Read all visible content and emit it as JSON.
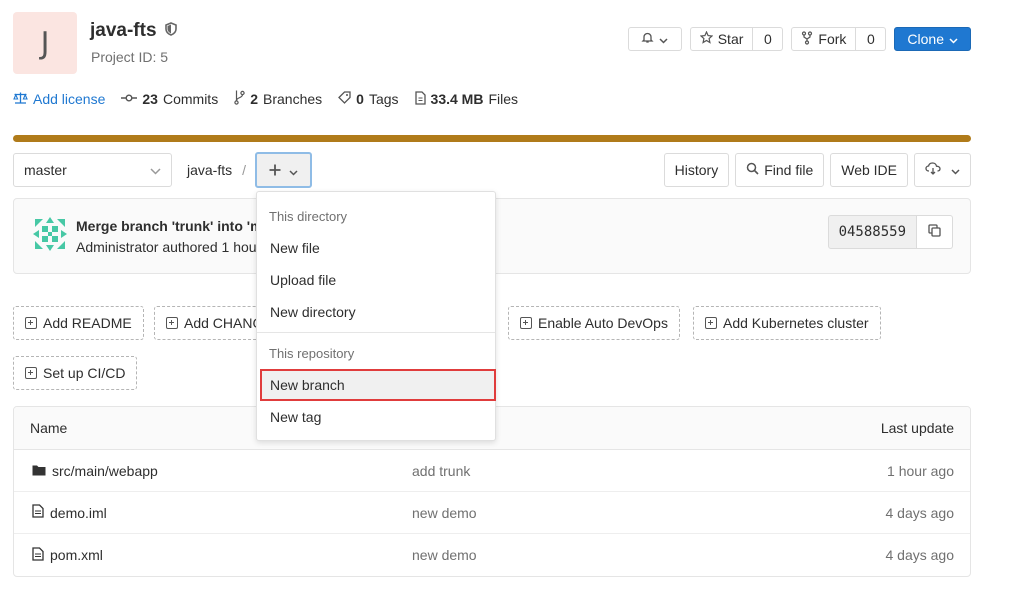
{
  "project": {
    "avatar_letter": "J",
    "name": "java-fts",
    "id_text": "Project ID: 5"
  },
  "actions": {
    "star_label": "Star",
    "star_count": "0",
    "fork_label": "Fork",
    "fork_count": "0",
    "clone_label": "Clone"
  },
  "stats": {
    "add_license": "Add license",
    "commits_count": "23",
    "commits_label": "Commits",
    "branches_count": "2",
    "branches_label": "Branches",
    "tags_count": "0",
    "tags_label": "Tags",
    "files_size": "33.4 MB",
    "files_label": "Files"
  },
  "storage_usage_fraction": 1.0,
  "colors": {
    "accent": "#1f78d1",
    "progress": "#b07b1a",
    "highlight": "#e03c3c"
  },
  "toolbar": {
    "branch": "master",
    "path": "java-fts",
    "path_sep": "/",
    "history": "History",
    "find_file": "Find file",
    "web_ide": "Web IDE"
  },
  "commit": {
    "title": "Merge branch 'trunk' into 'm",
    "meta": "Administrator authored 1 hou",
    "sha": "04588559"
  },
  "quick_actions": {
    "add_readme": "Add README",
    "add_changelog": "Add CHANG",
    "enable_devops": "Enable Auto DevOps",
    "add_k8s": "Add Kubernetes cluster",
    "setup_ci": "Set up CI/CD"
  },
  "dropdown": {
    "section1": "This directory",
    "new_file": "New file",
    "upload_file": "Upload file",
    "new_directory": "New directory",
    "section2": "This repository",
    "new_branch": "New branch",
    "new_tag": "New tag"
  },
  "table": {
    "col_name": "Name",
    "col_update": "Last update",
    "rows": [
      {
        "name": "src/main/webapp",
        "type": "folder-icon",
        "message": "add trunk",
        "time": "1 hour ago"
      },
      {
        "name": "demo.iml",
        "type": "file-icon",
        "message": "new demo",
        "time": "4 days ago"
      },
      {
        "name": "pom.xml",
        "type": "file-icon",
        "message": "new demo",
        "time": "4 days ago"
      }
    ]
  }
}
